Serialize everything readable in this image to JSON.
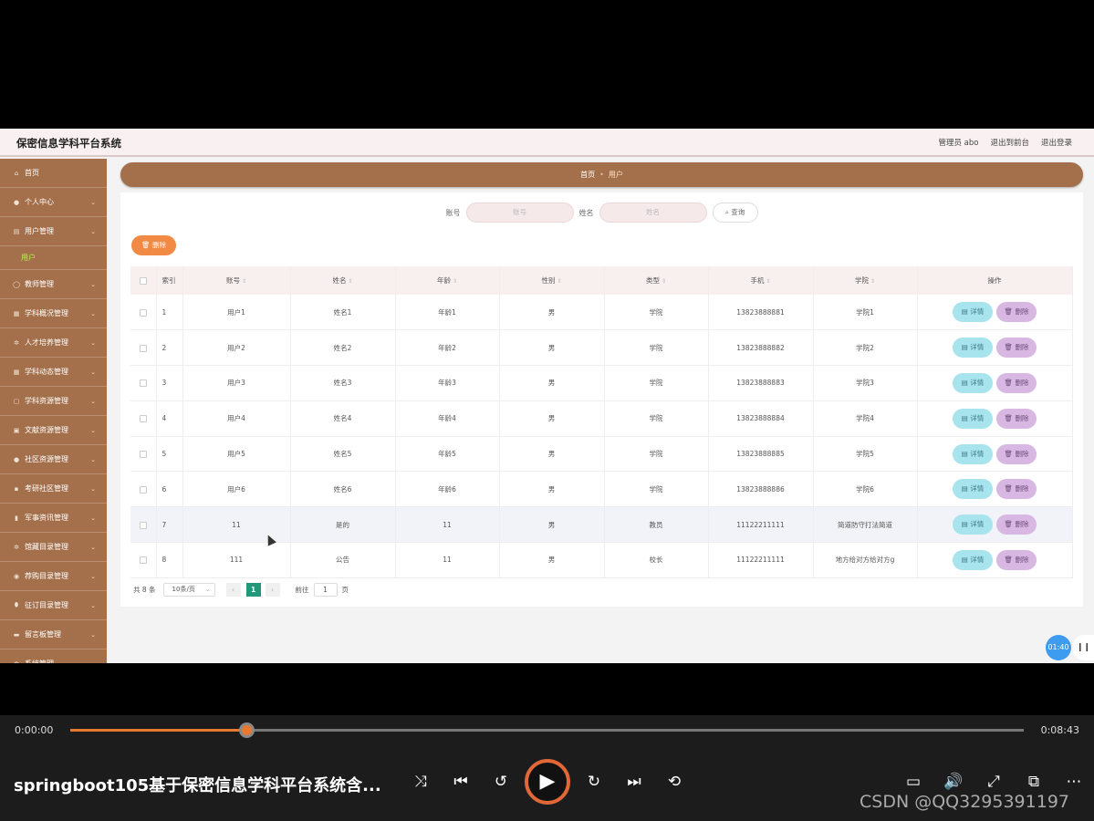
{
  "app": {
    "title": "保密信息学科平台系统",
    "nav": [
      "管理员 abo",
      "退出到前台",
      "退出登录"
    ]
  },
  "sidebar": {
    "items": [
      {
        "label": "首页",
        "icon": "home-icon",
        "has_chevron": false
      },
      {
        "label": "个人中心",
        "icon": "user-icon",
        "has_chevron": true
      },
      {
        "label": "用户管理",
        "icon": "document-icon",
        "has_chevron": true
      },
      {
        "label": "教师管理",
        "icon": "circle-icon",
        "has_chevron": true
      },
      {
        "label": "学科概况管理",
        "icon": "grid-icon",
        "has_chevron": true
      },
      {
        "label": "人才培养管理",
        "icon": "gear-icon",
        "has_chevron": true
      },
      {
        "label": "学科动态管理",
        "icon": "grid-icon",
        "has_chevron": true
      },
      {
        "label": "学科资源管理",
        "icon": "square-icon",
        "has_chevron": true
      },
      {
        "label": "文献资源管理",
        "icon": "folder-icon",
        "has_chevron": true
      },
      {
        "label": "社区资源管理",
        "icon": "user-icon",
        "has_chevron": true
      },
      {
        "label": "考研社区管理",
        "icon": "apps-icon",
        "has_chevron": true
      },
      {
        "label": "军事资讯管理",
        "icon": "chart-icon",
        "has_chevron": true
      },
      {
        "label": "馆藏目录管理",
        "icon": "gear-icon",
        "has_chevron": true
      },
      {
        "label": "荐购目录管理",
        "icon": "eye-icon",
        "has_chevron": true
      },
      {
        "label": "征订目录管理",
        "icon": "location-icon",
        "has_chevron": true
      },
      {
        "label": "留言板管理",
        "icon": "chat-icon",
        "has_chevron": true
      },
      {
        "label": "系统管理",
        "icon": "gear-icon",
        "has_chevron": true
      }
    ],
    "active_sub": "用户"
  },
  "breadcrumb": {
    "home": "首页",
    "current": "用户"
  },
  "search": {
    "account_label": "账号",
    "account_placeholder": "账号",
    "name_label": "姓名",
    "name_placeholder": "姓名",
    "search_button": "查询"
  },
  "batch_delete_label": "删除",
  "table": {
    "headers": [
      "索引",
      "账号",
      "姓名",
      "年龄",
      "性别",
      "类型",
      "手机",
      "学院",
      "操作"
    ],
    "sortable": [
      false,
      true,
      true,
      true,
      true,
      true,
      true,
      true,
      false
    ],
    "rows": [
      {
        "idx": "1",
        "account": "用户1",
        "name": "姓名1",
        "age": "年龄1",
        "gender": "男",
        "type": "学院",
        "phone": "13823888881",
        "college": "学院1"
      },
      {
        "idx": "2",
        "account": "用户2",
        "name": "姓名2",
        "age": "年龄2",
        "gender": "男",
        "type": "学院",
        "phone": "13823888882",
        "college": "学院2"
      },
      {
        "idx": "3",
        "account": "用户3",
        "name": "姓名3",
        "age": "年龄3",
        "gender": "男",
        "type": "学院",
        "phone": "13823888883",
        "college": "学院3"
      },
      {
        "idx": "4",
        "account": "用户4",
        "name": "姓名4",
        "age": "年龄4",
        "gender": "男",
        "type": "学院",
        "phone": "13823888884",
        "college": "学院4"
      },
      {
        "idx": "5",
        "account": "用户5",
        "name": "姓名5",
        "age": "年龄5",
        "gender": "男",
        "type": "学院",
        "phone": "13823888885",
        "college": "学院5"
      },
      {
        "idx": "6",
        "account": "用户6",
        "name": "姓名6",
        "age": "年龄6",
        "gender": "男",
        "type": "学院",
        "phone": "13823888886",
        "college": "学院6"
      },
      {
        "idx": "7",
        "account": "11",
        "name": "是的",
        "age": "11",
        "gender": "男",
        "type": "教员",
        "phone": "11122211111",
        "college": "简道防守打法简道"
      },
      {
        "idx": "8",
        "account": "111",
        "name": "公告",
        "age": "11",
        "gender": "男",
        "type": "校长",
        "phone": "11122211111",
        "college": "地方给对方给对方g"
      }
    ],
    "highlight_row": 6,
    "detail_label": "详情",
    "delete_label": "删除"
  },
  "pager": {
    "total": "共 8 条",
    "page_size": "10条/页",
    "current_page": "1",
    "goto_label": "前往",
    "goto_value": "1",
    "page_suffix": "页"
  },
  "timer_badge": "01:40",
  "player": {
    "current_time": "0:00:00",
    "total_time": "0:08:43",
    "progress": 0.185,
    "title": "springboot105基于保密信息学科平台系统含...",
    "watermark": "CSDN @QQ3295391197"
  }
}
